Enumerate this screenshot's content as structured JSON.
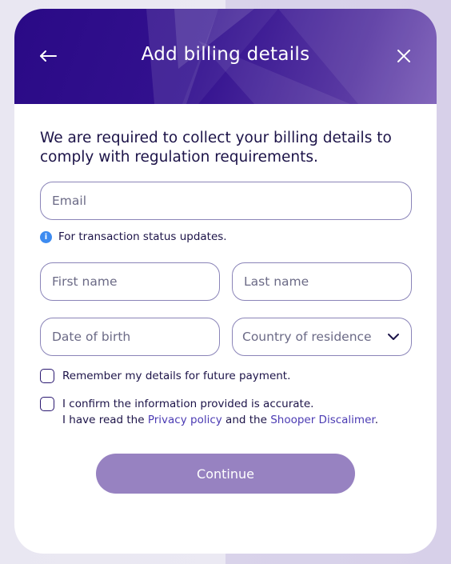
{
  "header": {
    "title": "Add billing details",
    "back_icon": "arrow-left-icon",
    "close_icon": "close-icon"
  },
  "intro_text": "We are required to collect your billing details to comply with regulation requirements.",
  "form": {
    "email": {
      "placeholder": "Email",
      "value": ""
    },
    "email_hint": "For transaction status updates.",
    "first_name": {
      "placeholder": "First name",
      "value": ""
    },
    "last_name": {
      "placeholder": "Last name",
      "value": ""
    },
    "date_of_birth": {
      "placeholder": "Date of birth",
      "value": ""
    },
    "country": {
      "placeholder": "Country of residence",
      "selected": ""
    },
    "remember_label": "Remember my details for future payment.",
    "confirm_line1": "I confirm the information provided is accurate.",
    "confirm_prefix": "I have read the ",
    "privacy_link": "Privacy policy",
    "confirm_mid": " and the ",
    "disclaimer_link": "Shooper Discalimer",
    "confirm_suffix": ".",
    "remember_checked": false,
    "confirm_checked": false
  },
  "continue_label": "Continue",
  "colors": {
    "header_dark": "#2a0a86",
    "header_light": "#7a5cb7",
    "text": "#1c1348",
    "link": "#4b3bb3",
    "button": "#9782c1",
    "info": "#3d8bf0"
  }
}
